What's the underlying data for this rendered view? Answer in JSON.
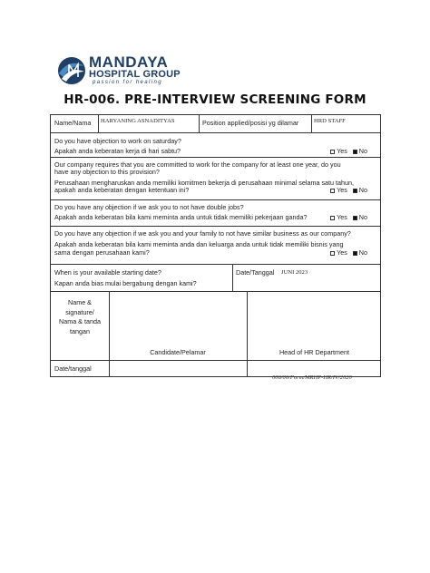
{
  "logo": {
    "name": "MANDAYA",
    "group": "HOSPITAL GROUP",
    "tagline": "passion for healing",
    "colors": {
      "primary": "#1f3f66",
      "accent": "#4a8cc7"
    }
  },
  "form": {
    "title": "HR-006. PRE-INTERVIEW SCREENING FORM",
    "name_label": "Name/Nama",
    "name_value": "HARYANING ASNADITYAS",
    "position_label": "Position applied/posisi yg dilamar",
    "position_value": "HRD STAFF",
    "yes_label": "Yes",
    "no_label": "No",
    "questions": [
      {
        "en": "Do you have objection to work on saturday?",
        "id": "Apakah anda keberatan kerja di hari sabtu?",
        "answer": "No"
      },
      {
        "en": "Our company requires that you are committed to work for the company for at least one year, do you",
        "en2": "have any objection to this provision?",
        "id": "Perusahaan mengharuskan anda memiliki komitmen bekerja di perusahaan minimal selama satu tahun,",
        "id2": "apakah anda keberatan dengan ketentuan ini?",
        "answer": "No"
      },
      {
        "en": "Do you have any objection if we ask you to not have double jobs?",
        "id": "Apakah anda keberatan bila kami meminta anda untuk tidak memiliki pekerjaan ganda?",
        "answer": "No"
      },
      {
        "en": "Do you have any objection if we ask you and your family to not have similar business as our company?",
        "id": "Apakah anda keberatan bila kami meminta anda dan keluarga anda untuk tidak memiliki bisnis yang",
        "id2": "sama dengan perusahaan kami?",
        "answer": "No"
      }
    ],
    "start_label_en": "When is your available starting date?",
    "start_label_id": "Kapan anda bias mulai bergabung dengan kami?",
    "date_label": "Date/Tanggal",
    "date_value": "JUNI 2023",
    "signature_label": [
      "Name &",
      "signature/",
      "Nama & tanda",
      "tangan"
    ],
    "candidate_label": "Candidate/Pelamar",
    "head_label": "Head of HR Department",
    "date_bottom_label": "Date/tanggal"
  },
  "footer_code": "006/00/Form/MRHP-HR/IV/2020"
}
